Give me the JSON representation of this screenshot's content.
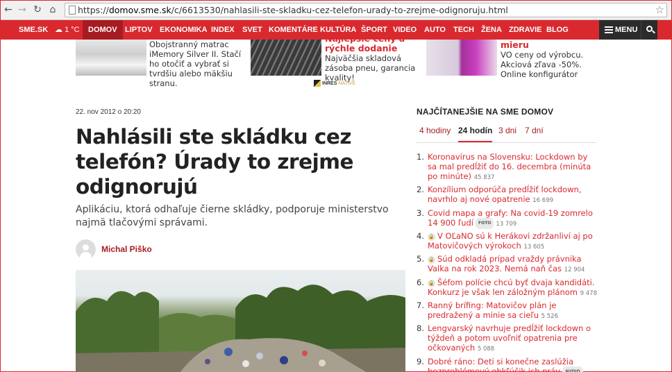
{
  "browser": {
    "url_prefix": "https://",
    "url_host": "domov.sme.sk",
    "url_path": "/c/6613530/nahlasili-ste-skladku-cez-telefon-urady-to-zrejme-odignoruju.html"
  },
  "topnav": {
    "site": "SME.SK",
    "weather": "1 °C",
    "items": [
      "DOMOV",
      "LIPTOV",
      "EKONOMIKA",
      "INDEX",
      "SVET",
      "KOMENTÁRE",
      "KULTÚRA",
      "ŠPORT",
      "VIDEO",
      "AUTO",
      "TECH",
      "ŽENA",
      "ZDRAVIE",
      "BLOG"
    ],
    "menu_label": "MENU"
  },
  "ads": {
    "ad1_text": "Obojstranný matrac iMemory Silver II. Stačí ho otočiť a vybrať si tvrdšiu alebo mäkšiu stranu.",
    "ad2_title": "Najlepšie ceny a rýchle dodanie",
    "ad2_text": "Najväčšia skladová zásoba pneu, garancia kvality!",
    "ad3_title": "mieru",
    "ad3_text": "VO ceny od výrobcu. Akciová zľava -50%. Online konfigurátor",
    "network_name": "INRES",
    "network_suffix": "NATIVE"
  },
  "article": {
    "date": "22. nov 2012 o 20:20",
    "title": "Nahlásili ste skládku cez telefón? Úrady to zrejme odignorujú",
    "perex": "Aplikáciu, ktorá odhaľuje čierne skládky, podporuje ministerstvo najmä tlačovými správami.",
    "author": "Michal Piško"
  },
  "sidebar": {
    "heading": "NAJČÍTANEJŠIE NA SME DOMOV",
    "tabs": [
      "4 hodiny",
      "24 hodín",
      "3 dni",
      "7 dní"
    ],
    "items": [
      {
        "num": "1.",
        "title": "Koronavírus na Slovensku: Lockdown by sa mal predĺžiť do 16. decembra (minúta po minúte)",
        "count": "45 837"
      },
      {
        "num": "2.",
        "title": "Konzílium odporúča predĺžiť lockdown, navrhlo aj nové opatrenie",
        "count": "16 699"
      },
      {
        "num": "3.",
        "title": "Covid mapa a grafy: Na covid-19 zomrelo 14 900 ľudí",
        "badge": "FOTO",
        "count": "13 709"
      },
      {
        "num": "4.",
        "title": "V OĽaNO sú k Herákovi zdržanliví aj po Matovičových výrokoch",
        "count": "13 605"
      },
      {
        "num": "5.",
        "title": "Súd odkladá prípad vraždy právnika Valka na rok 2023. Nemá naň čas",
        "count": "12 904"
      },
      {
        "num": "6.",
        "title": "Šéfom polície chcú byť dvaja kandidáti. Konkurz je však len záložným plánom",
        "count": "9 478"
      },
      {
        "num": "7.",
        "title": "Ranný brífing: Matovičov plán je predražený a minie sa cieľu",
        "count": "5 526"
      },
      {
        "num": "8.",
        "title": "Lengvarský navrhuje predĺžiť lockdown o týždeň a potom uvoľniť opatrenia pre očkovaných",
        "count": "5 088"
      },
      {
        "num": "9.",
        "title": "Dobré ráno: Deti si konečne zaslúžia bezproblémový obkľúčik ich práv",
        "badge": "AUDIO",
        "count": ""
      }
    ]
  },
  "colors": {
    "brand_red": "#d9292f",
    "dark_red": "#a71c22"
  }
}
